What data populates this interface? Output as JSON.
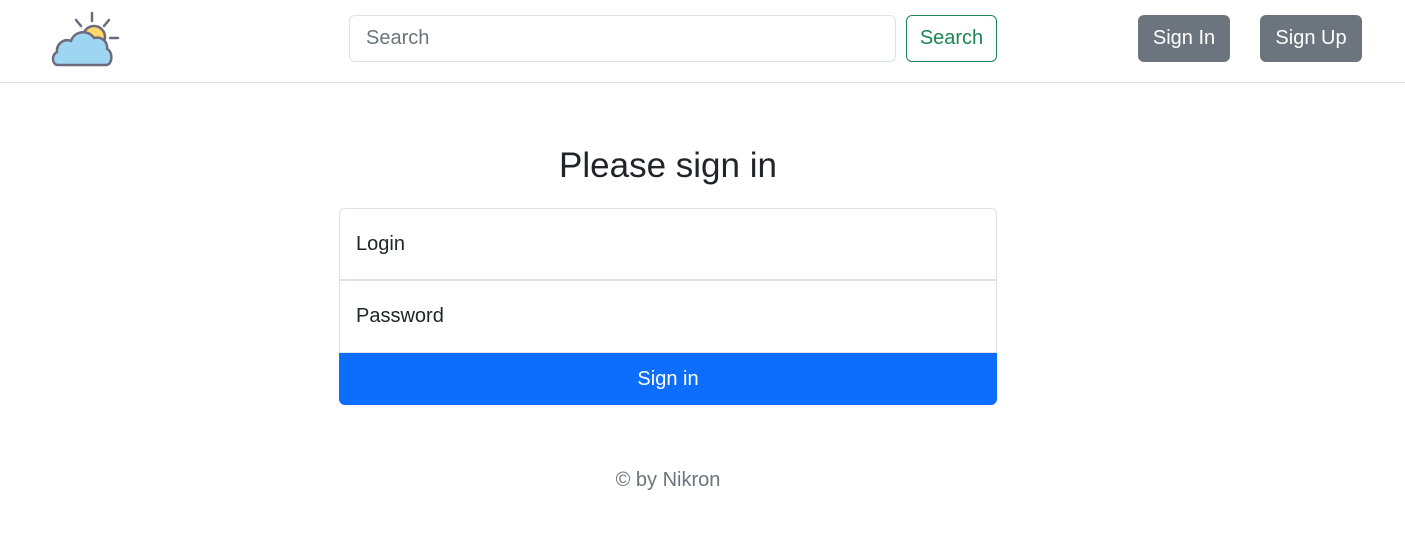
{
  "navbar": {
    "logo_icon": "weather-cloud-sun-icon",
    "search": {
      "placeholder": "Search",
      "value": "",
      "button_label": "Search"
    },
    "sign_in_label": "Sign In",
    "sign_up_label": "Sign Up"
  },
  "form": {
    "title": "Please sign in",
    "login_placeholder": "Login",
    "password_placeholder": "Password",
    "submit_label": "Sign in"
  },
  "footer": {
    "text": "© by Nikron"
  },
  "colors": {
    "primary": "#0d6efd",
    "success": "#198754",
    "secondary": "#6c757d",
    "border": "#dee2e6"
  }
}
